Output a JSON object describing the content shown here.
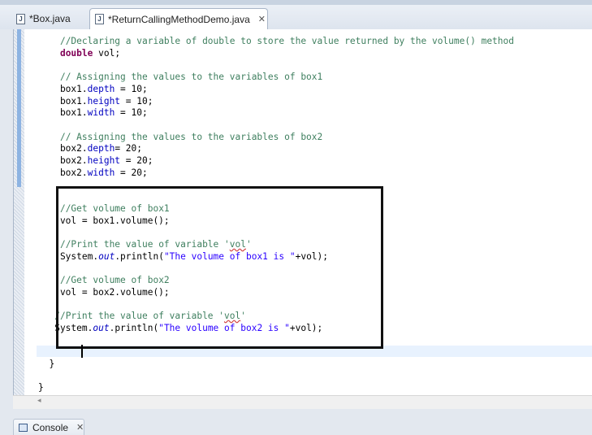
{
  "tabs": [
    {
      "label": "*Box.java",
      "active": false
    },
    {
      "label": "*ReturnCallingMethodDemo.java",
      "active": true
    }
  ],
  "icons": {
    "file": "java-file-icon",
    "close": "close-tab-icon",
    "console": "console-icon"
  },
  "code_lines": [
    "    //Declaring a variable of double to store the value returned by the volume() method",
    "    double vol;",
    "",
    "    // Assigning the values to the variables of box1",
    "    box1.depth = 10;",
    "    box1.height = 10;",
    "    box1.width = 10;",
    "",
    "    // Assigning the values to the variables of box2",
    "    box2.depth= 20;",
    "    box2.height = 20;",
    "    box2.width = 20;",
    "",
    "",
    "    //Get volume of box1",
    "    vol = box1.volume();",
    "",
    "    //Print the value of variable 'vol'",
    "    System.out.println(\"The volume of box1 is \"+vol);",
    "",
    "    //Get volume of box2",
    "    vol = box2.volume();",
    "",
    "   //Print the value of variable 'vol'",
    "   System.out.println(\"The volume of box2 is \"+vol);",
    "",
    "",
    "  }",
    "",
    "}"
  ],
  "bottom_panel": {
    "console_label": "Console"
  },
  "colors": {
    "comment": "#3f7f5f",
    "keyword": "#7f0055",
    "field": "#0000c0",
    "string": "#2a00ff",
    "highlight_box": "#111111"
  }
}
